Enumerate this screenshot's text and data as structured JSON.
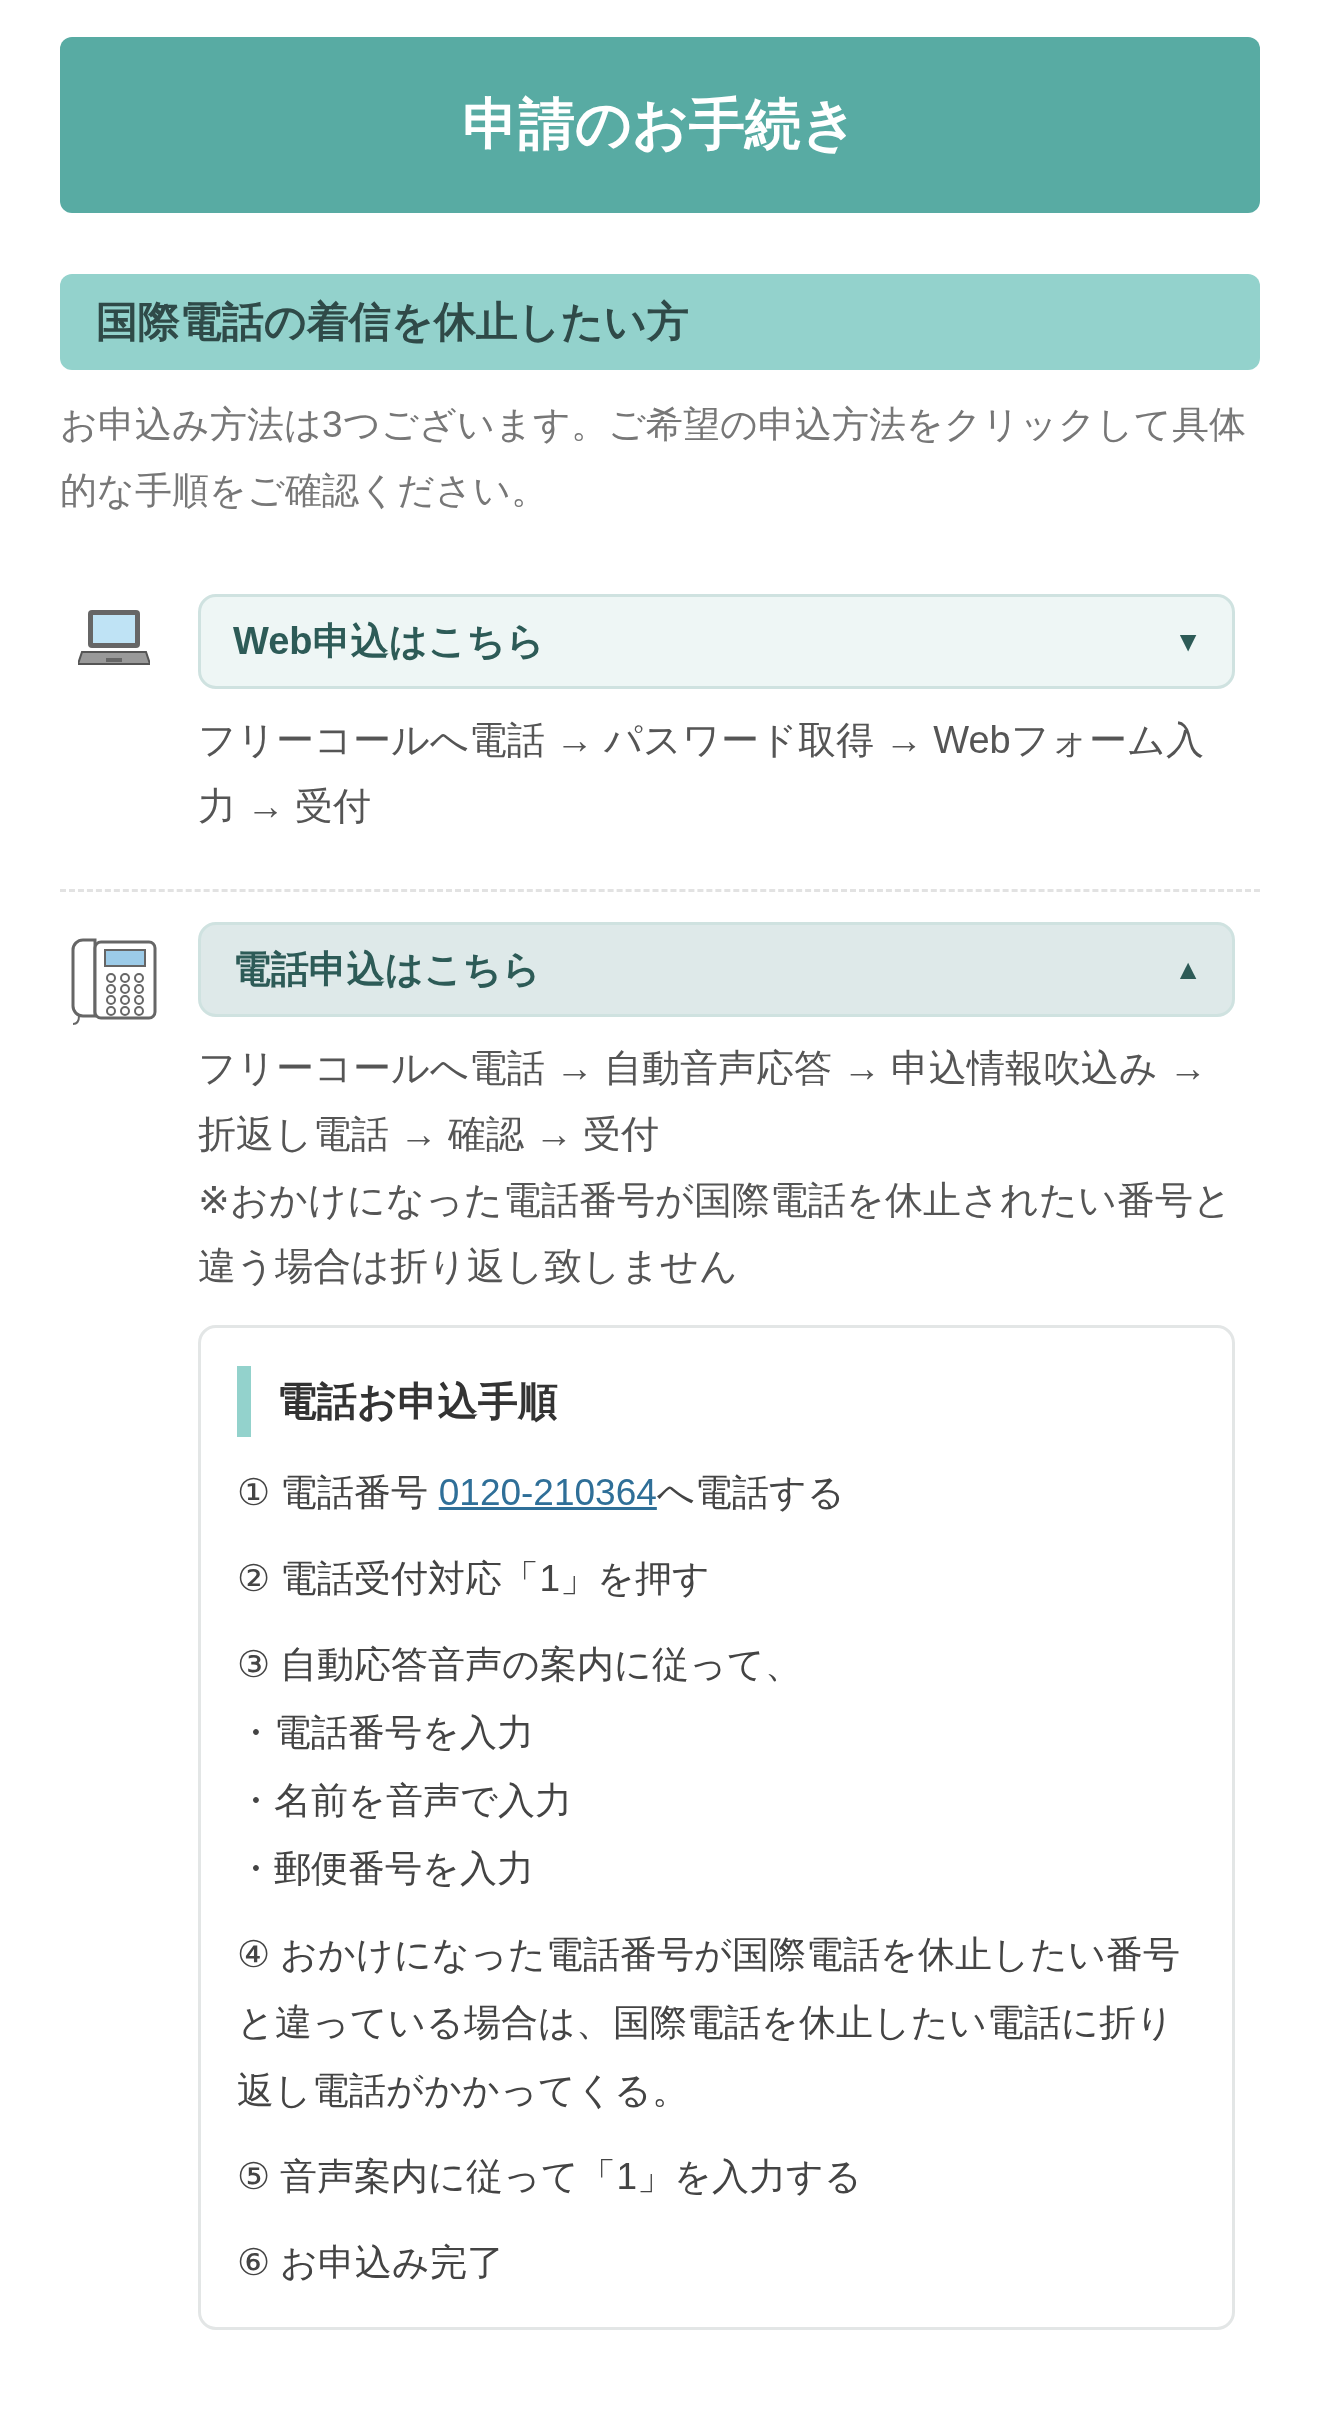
{
  "header": {
    "title": "申請のお手続き"
  },
  "section": {
    "title": "国際電話の着信を休止したい方",
    "intro": "お申込み方法は3つございます。ご希望の申込方法をクリックして具体的な手順をご確認ください。"
  },
  "methods": [
    {
      "kind": "laptop",
      "label": "Web申込はこちら",
      "expanded": false,
      "arrow": "▼",
      "flow": [
        "フリーコールへ電話 → パスワード取得 → Webフォーム入力 → 受付"
      ]
    },
    {
      "kind": "phone",
      "label": "電話申込はこちら",
      "expanded": true,
      "arrow": "▲",
      "flow": [
        "フリーコールへ電話 → 自動音声応答 → 申込情報吹込み → 折返し電話 → 確認 → 受付",
        "※おかけになった電話番号が国際電話を休止されたい番号と違う場合は折り返し致しません"
      ],
      "procedure": {
        "title": "電話お申込手順",
        "steps": [
          {
            "kind": "step",
            "marker": "①",
            "text": "電話番号 ",
            "link": "0120-210364",
            "after": "へ電話する"
          },
          {
            "kind": "step",
            "marker": "②",
            "text": "電話受付対応「1」を押す"
          },
          {
            "kind": "step",
            "marker": "③",
            "text": "自動応答音声の案内に従って、"
          },
          {
            "kind": "bullet",
            "marker": "・",
            "text": "電話番号を入力"
          },
          {
            "kind": "bullet",
            "marker": "・",
            "text": "名前を音声で入力"
          },
          {
            "kind": "bullet",
            "marker": "・",
            "text": "郵便番号を入力"
          },
          {
            "kind": "step",
            "marker": "④",
            "text": "おかけになった電話番号が国際電話を休止したい番号と違っている場合は、国際電話を休止したい電話に折り返し電話がかかってくる。"
          },
          {
            "kind": "step",
            "marker": "⑤",
            "text": "音声案内に従って「1」を入力する"
          },
          {
            "kind": "step",
            "marker": "⑥",
            "text": "お申込み完了"
          }
        ]
      }
    }
  ]
}
